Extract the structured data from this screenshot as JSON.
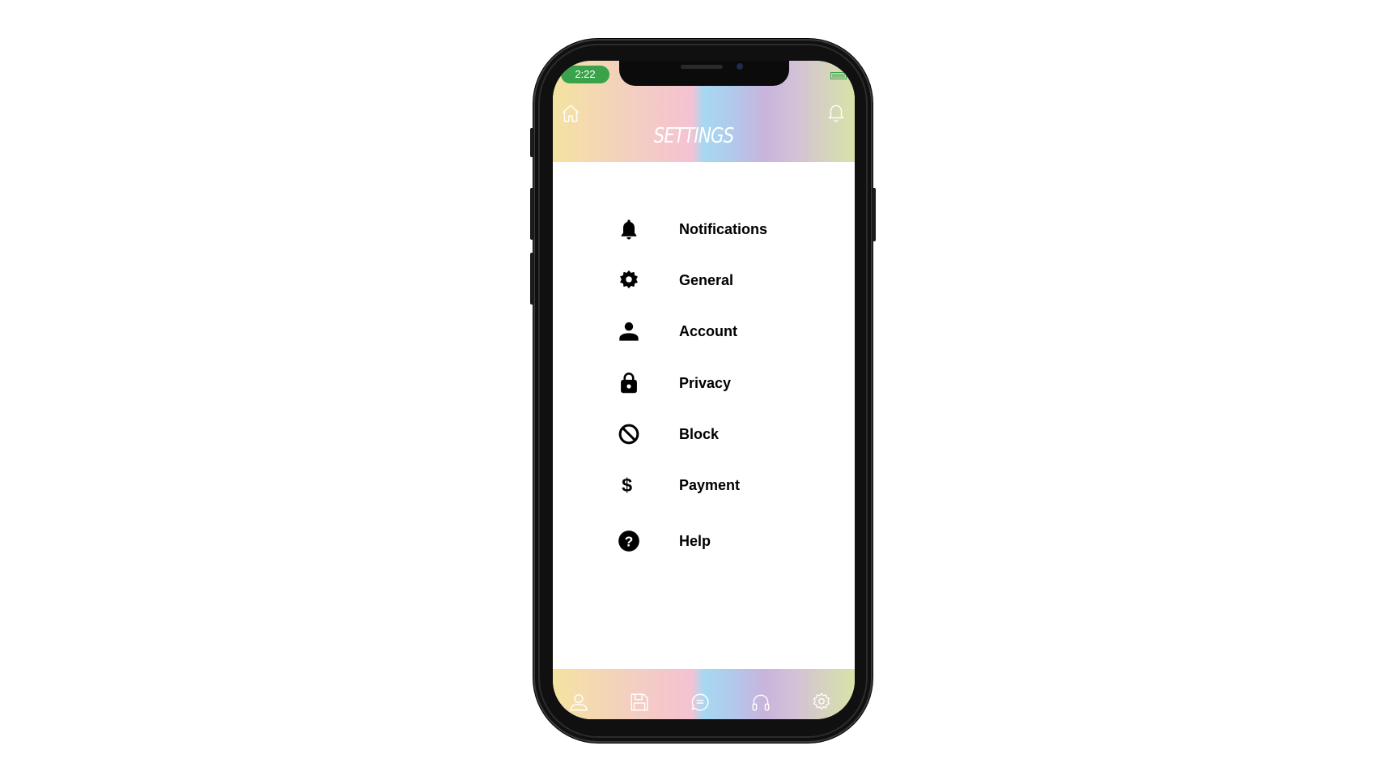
{
  "status_bar": {
    "time": "2:22"
  },
  "header": {
    "title": "SETTINGS",
    "left_icon": "home-icon",
    "right_icon": "bell-outline-icon"
  },
  "menu": {
    "items": [
      {
        "label": "Notifications",
        "icon": "bell-icon"
      },
      {
        "label": "General",
        "icon": "gear-icon"
      },
      {
        "label": "Account",
        "icon": "person-icon"
      },
      {
        "label": "Privacy",
        "icon": "lock-icon"
      },
      {
        "label": "Block",
        "icon": "block-icon"
      },
      {
        "label": "Payment",
        "icon": "dollar-icon"
      },
      {
        "label": "Help",
        "icon": "help-icon"
      }
    ]
  },
  "tabbar": {
    "tabs": [
      "profile-icon",
      "save-icon",
      "chat-icon",
      "headphones-icon",
      "settings-icon"
    ]
  },
  "colors": {
    "time_pill": "#3aa24a",
    "battery": "#3aa24a",
    "gradient": [
      "#f4e3a0",
      "#f4c2d2",
      "#a7d8f2",
      "#c8b4dc",
      "#d9e3a6"
    ]
  }
}
